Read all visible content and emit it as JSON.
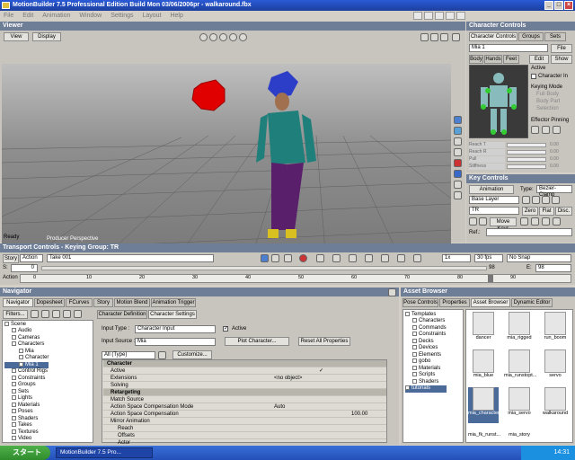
{
  "window": {
    "title": "MotionBuilder 7.5 Professional Edition Build Mon 03/06/2006pr - walkaround.fbx"
  },
  "menu": [
    "File",
    "Edit",
    "Animation",
    "Window",
    "Settings",
    "Layout",
    "Help"
  ],
  "viewer": {
    "title": "Viewer",
    "view_btn": "View",
    "display_btn": "Display",
    "perspective": "Producer Perspective",
    "status": "Ready"
  },
  "char_controls": {
    "title": "Character Controls",
    "tabs": [
      "Character Controls",
      "Groups",
      "Sets"
    ],
    "character": "Mia 1",
    "file": "File",
    "subtabs": [
      "Body",
      "Hands",
      "Feet"
    ],
    "edit": "Edit",
    "show": "Show",
    "active": "Active",
    "character_in": "Character In",
    "keying_mode": "Keying Mode",
    "keying_opts": [
      "Full Body",
      "Body Part",
      "Selection"
    ],
    "effector_pinning": "Effector Pinning",
    "slider_labels": [
      "Reach T",
      "Reach R",
      "Pull",
      "Stiffness"
    ],
    "slider_values": [
      "0.00",
      "0.00",
      "0.00",
      "0.00"
    ]
  },
  "key_controls": {
    "title": "Key Controls",
    "animation": "Animation",
    "type_label": "Type:",
    "type_value": "Bezier-Clamp",
    "layer": "Base Layer",
    "tr": "TR",
    "zero": "Zero",
    "flat": "Flat",
    "disc": "Disc.",
    "move_keys": "Move Keys",
    "ref_label": "Ref.:"
  },
  "transport": {
    "title": "Transport Controls  -  Keying Group: TR",
    "story": "Story",
    "action": "Action",
    "take": "Take 001",
    "speed": "1x",
    "fps": "30 fps",
    "snap": "No Snap",
    "s_label": "S:",
    "s_value": "0",
    "e_label": "E:",
    "e_value": "98",
    "start_frame": "0",
    "end_frame": "98",
    "timeline_ticks": [
      "0",
      "10",
      "20",
      "30",
      "40",
      "50",
      "60",
      "70",
      "80",
      "90"
    ],
    "action_label": "Action"
  },
  "navigator": {
    "title": "Navigator",
    "tabs": [
      "Navigator",
      "Dopesheet",
      "FCurves",
      "Story",
      "Motion Blend",
      "Animation Trigger"
    ],
    "filters": "Filters...",
    "tree": [
      "Scene",
      "Audio",
      "Cameras",
      "Characters",
      "Mia",
      "Character",
      "Mia 1",
      "Control Rigs",
      "Constraints",
      "Groups",
      "Sets",
      "Lights",
      "Materials",
      "Poses",
      "Shaders",
      "Takes",
      "Textures",
      "Video"
    ],
    "def_tabs": [
      "Character Definition",
      "Character Settings"
    ],
    "input_type_label": "Input Type :",
    "input_type": "Character Input",
    "active": "Active",
    "input_source_label": "Input Source :",
    "input_source": "Mia",
    "plot_btn": "Plot Character...",
    "reset_btn": "Reset All Properties",
    "all_type": "All (Type)",
    "customize": "Customize...",
    "props": [
      {
        "name": "Character",
        "val": "",
        "hd": true
      },
      {
        "name": "Active",
        "val": ""
      },
      {
        "name": "Extensions",
        "val": "<no object>"
      },
      {
        "name": "Solving",
        "val": "",
        "hd": true
      },
      {
        "name": "Retargeting",
        "val": "",
        "hd": true
      },
      {
        "name": "Match Source",
        "val": ""
      },
      {
        "name": "Action Space Compensation Mode",
        "val": "Auto"
      },
      {
        "name": "Action Space Compensation",
        "val": "100.00"
      },
      {
        "name": "Mirror Animation",
        "val": ""
      },
      {
        "name": "Reach",
        "val": ""
      },
      {
        "name": "Offsets",
        "val": ""
      },
      {
        "name": "Actor",
        "val": ""
      }
    ]
  },
  "asset": {
    "title": "Asset Browser",
    "tabs": [
      "Pose Controls",
      "Properties",
      "Asset Browser",
      "Dynamic Editor"
    ],
    "tree": [
      "Templates",
      "Characters",
      "Commands",
      "Constraints",
      "Decks",
      "Devices",
      "Elements",
      "gobo",
      "Materials",
      "Scripts",
      "Shaders",
      "tutorials"
    ],
    "items": [
      "dancer",
      "mia_rigged",
      "run_boom",
      "mia_blue",
      "mia_runstopt...",
      "servo",
      "mia_characterized",
      "mia_servo",
      "walkaround",
      "mia_fk_runst...",
      "mia_story",
      ""
    ]
  },
  "taskbar": {
    "start": "スタート",
    "app": "MotionBuilder 7.5 Pro...",
    "time": "14:31"
  }
}
